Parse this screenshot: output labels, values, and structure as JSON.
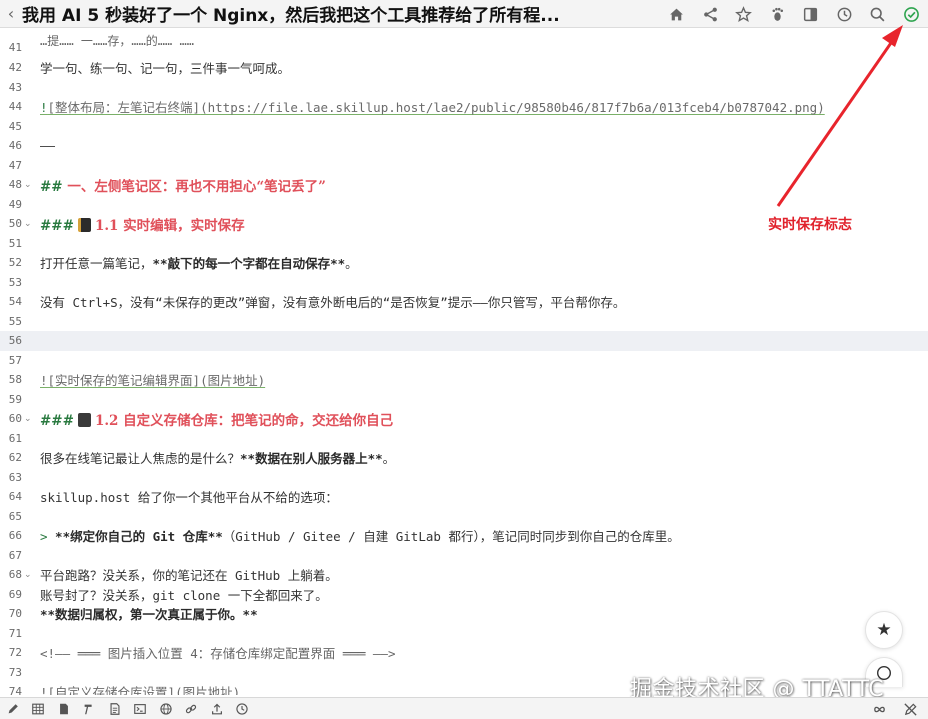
{
  "window": {
    "title": "我用 AI 5 秒装好了一个 Nginx，然后我把这个工具推荐给了所有程..."
  },
  "toolbar": {
    "icons": [
      "home-icon",
      "share-icon",
      "star-icon",
      "footprint-icon",
      "book-icon",
      "history-icon",
      "search-icon",
      "saved-check-icon"
    ],
    "saved_color": "#2ea44f"
  },
  "editor": {
    "line_41": {
      "num": "41",
      "text": "…提…… 一……存，……的…… ……"
    },
    "line_42": {
      "num": "42",
      "text": "学一句、练一句、记一句，三件事一气呵成。"
    },
    "line_43": {
      "num": "43"
    },
    "line_44": {
      "num": "44",
      "prefix": "!",
      "alt": "[整体布局：左笔记右终端]",
      "url": "(https://file.lae.skillup.host/lae2/public/98580b46/817f7b6a/013fceb4/b0787042.png)"
    },
    "line_45": {
      "num": "45"
    },
    "line_46": {
      "num": "46",
      "text": "——"
    },
    "line_47": {
      "num": "47"
    },
    "line_48": {
      "num": "48",
      "marker": "##",
      "text": " 一、左侧笔记区：再也不用担心“笔记丢了”"
    },
    "line_49": {
      "num": "49"
    },
    "line_50": {
      "num": "50",
      "marker": "###",
      "text": "1.1 实时编辑，实时保存"
    },
    "line_51": {
      "num": "51"
    },
    "line_52": {
      "num": "52",
      "before": "打开任意一篇笔记，",
      "bold": "**敲下的每一个字都在自动保存**",
      "after": "。"
    },
    "line_53": {
      "num": "53"
    },
    "line_54": {
      "num": "54",
      "text": "没有 Ctrl+S，没有“未保存的更改”弹窗，没有意外断电后的“是否恢复”提示——你只管写，平台帮你存。"
    },
    "line_55": {
      "num": "55"
    },
    "line_56": {
      "num": "56"
    },
    "line_57": {
      "num": "57"
    },
    "line_58": {
      "num": "58",
      "text": "![实时保存的笔记编辑界面](图片地址)"
    },
    "line_59": {
      "num": "59"
    },
    "line_60": {
      "num": "60",
      "marker": "###",
      "text": "1.2 自定义存储仓库：把笔记的命，交还给你自己"
    },
    "line_61": {
      "num": "61"
    },
    "line_62": {
      "num": "62",
      "before": "很多在线笔记最让人焦虑的是什么？",
      "bold": "**数据在别人服务器上**",
      "after": "。"
    },
    "line_63": {
      "num": "63"
    },
    "line_64": {
      "num": "64",
      "text": "skillup.host 给了你一个其他平台从不给的选项："
    },
    "line_65": {
      "num": "65"
    },
    "line_66": {
      "num": "66",
      "quote": ">",
      "bold": " **绑定你自己的 Git 仓库**",
      "after": "（GitHub / Gitee / 自建 GitLab 都行），笔记同时同步到你自己的仓库里。"
    },
    "line_67": {
      "num": "67"
    },
    "line_68": {
      "num": "68",
      "text": "平台跑路？没关系，你的笔记还在 GitHub 上躺着。"
    },
    "line_69": {
      "num": "69",
      "text": "账号封了？没关系，git clone 一下全都回来了。"
    },
    "line_70": {
      "num": "70",
      "bold": "**数据归属权，第一次真正属于你。**"
    },
    "line_71": {
      "num": "71"
    },
    "line_72": {
      "num": "72",
      "text": "<!—— ═══ 图片插入位置 4：存储仓库绑定配置界面 ═══ ——>"
    },
    "line_73": {
      "num": "73"
    },
    "line_74": {
      "num": "74",
      "text": "![自定义存储仓库设置](图片地址)"
    }
  },
  "annotation": {
    "label": "实时保存标志",
    "color": "#e0202a"
  },
  "watermark": "掘金技术社区 @ TTATTC",
  "bottombar": {
    "icons": [
      "edit-icon",
      "table-icon",
      "file-icon",
      "format-icon",
      "doc-icon",
      "terminal-icon",
      "globe-icon",
      "link-icon",
      "upload-icon",
      "history-icon"
    ],
    "right_icons": [
      "infinity-icon",
      "no-write-icon"
    ]
  }
}
